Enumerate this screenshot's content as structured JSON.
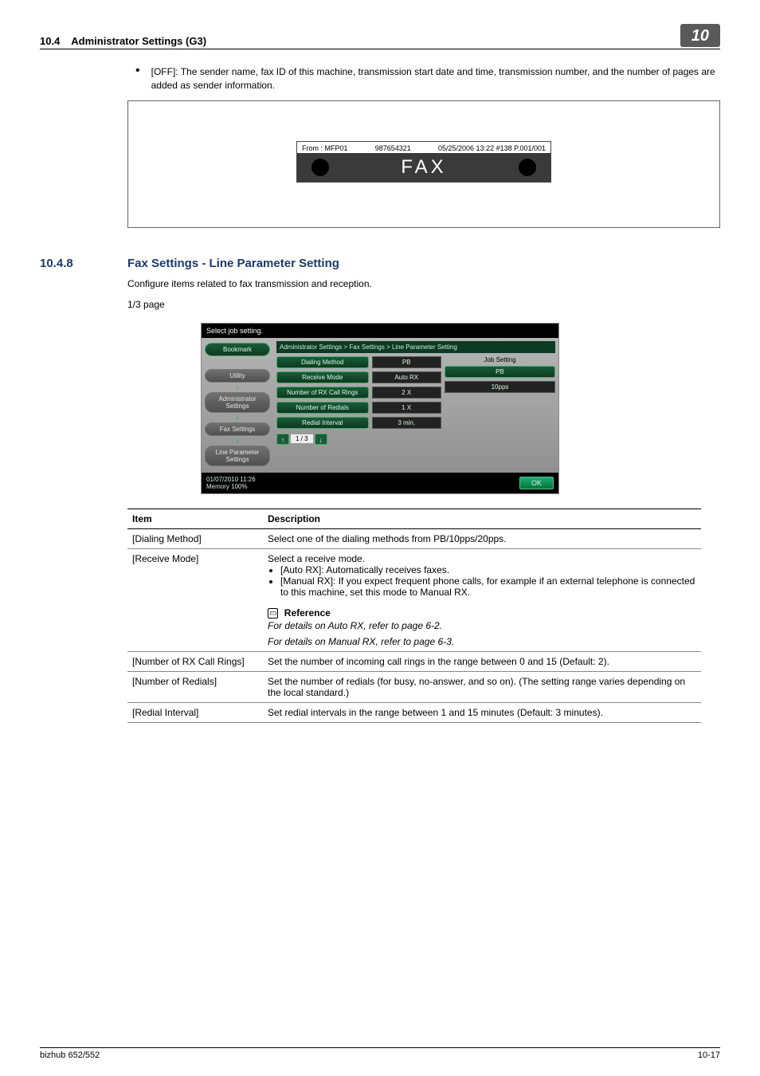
{
  "header": {
    "section_ref": "10.4",
    "section_title": "Administrator Settings (G3)",
    "tab": "10"
  },
  "top_bullet": "[OFF]: The sender name, fax ID of this machine, transmission start date and time, transmission number, and the number of pages are added as sender information.",
  "fax_preview": {
    "from": "From : MFP01",
    "id": "987654321",
    "stamp": "05/25/2006 13:22 #138 P.001/001",
    "label": "FAX"
  },
  "section": {
    "num": "10.4.8",
    "title": "Fax Settings - Line Parameter Setting",
    "intro": "Configure items related to fax transmission and reception.",
    "pager": "1/3 page"
  },
  "device": {
    "prompt": "Select job setting.",
    "bookmark": "Bookmark",
    "nav": [
      "Utility",
      "Administrator Settings",
      "Fax Settings",
      "Line Parameter Settings"
    ],
    "crumb": "Administrator Settings  >  Fax Settings  >  Line Parameter Setting",
    "rows": [
      {
        "label": "Dialing Method",
        "value": "PB"
      },
      {
        "label": "Receive Mode",
        "value": "Auto RX"
      },
      {
        "label": "Number of RX Call Rings",
        "value": "2  X"
      },
      {
        "label": "Number of Redials",
        "value": "1  X"
      },
      {
        "label": "Redial Interval",
        "value": "3  min."
      }
    ],
    "side_title": "Job Setting",
    "side_vals": [
      "PB",
      "10pps"
    ],
    "pager": "1 /  3",
    "footer_line1": "01/07/2010    11:26",
    "footer_line2": "Memory        100%",
    "ok": "OK"
  },
  "table": {
    "head": {
      "c1": "Item",
      "c2": "Description"
    },
    "rows": {
      "dialing": {
        "item": "[Dialing Method]",
        "desc": "Select one of the dialing methods from PB/10pps/20pps."
      },
      "receive": {
        "item": "[Receive Mode]",
        "desc_lead": "Select a receive mode.",
        "b1": "[Auto RX]: Automatically receives faxes.",
        "b2": "[Manual RX]: If you expect frequent phone calls, for example if an external telephone is connected to this machine, set this mode to Manual RX.",
        "ref_title": "Reference",
        "ref1": "For details on Auto RX, refer to page 6-2.",
        "ref2": "For details on Manual RX, refer to page 6-3."
      },
      "rxrings": {
        "item": "[Number of RX Call Rings]",
        "desc": "Set the number of incoming call rings in the range between 0 and 15 (Default: 2)."
      },
      "redials": {
        "item": "[Number of Redials]",
        "desc": "Set the number of redials (for busy, no-answer, and so on). (The setting range varies depending on the local standard.)"
      },
      "interval": {
        "item": "[Redial Interval]",
        "desc": "Set redial intervals in the range between 1 and 15 minutes (Default: 3 minutes)."
      }
    }
  },
  "footer": {
    "left": "bizhub 652/552",
    "right": "10-17"
  }
}
